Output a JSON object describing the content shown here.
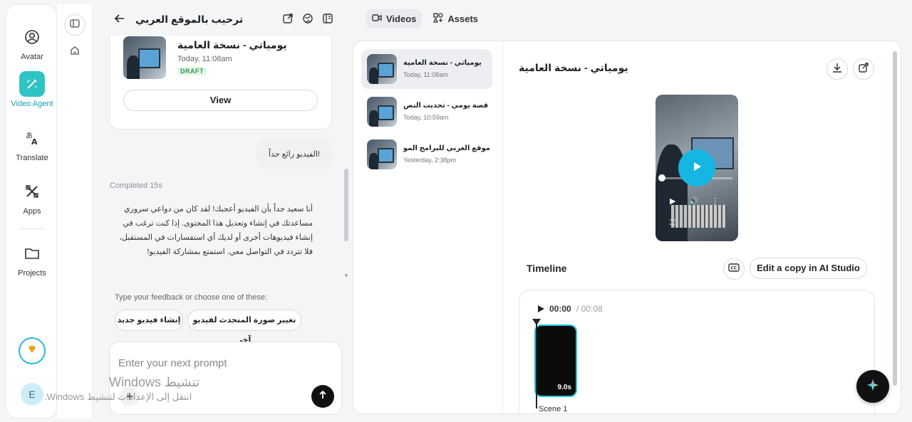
{
  "rail": {
    "items": [
      {
        "label": "Avatar",
        "icon": "avatar-icon"
      },
      {
        "label": "Video Agent",
        "icon": "video-agent-icon"
      },
      {
        "label": "Translate",
        "icon": "translate-icon"
      },
      {
        "label": "Apps",
        "icon": "apps-icon"
      },
      {
        "label": "Projects",
        "icon": "folder-icon"
      }
    ],
    "user_initial": "E"
  },
  "chat": {
    "title": "ترحيب بالموقع العربي",
    "video_card": {
      "title": "يومياتي - نسخة العامية",
      "time": "Today, 11:08am",
      "status": "DRAFT",
      "view_label": "View"
    },
    "user_message": "!الفيديو رائع جداً",
    "completed": "Completed 15s",
    "reply": "أنا سعيد جداً بأن الفيديو أعجبك! لقد كان من دواعي سروري مساعدتك في إنشاء وتعديل هذا المحتوى. إذا كنت ترغب في إنشاء فيديوهات أخرى أو لديك أي استفسارات في المستقبل، فلا تتردد في التواصل معي. استمتع بمشاركة الفيديو!",
    "feedback_hint": "Type your feedback or choose one of these:",
    "chips": [
      "إنشاء فيديو جديد",
      "تغيير صورة المتحدث لفيديو آخر"
    ],
    "prompt_placeholder": "Enter your next prompt"
  },
  "watermark": {
    "line1": "Windows تنشيط",
    "line2": "انتقل إلى الإعدادات لتنشيط Windows."
  },
  "tabs": [
    {
      "label": "Videos",
      "active": true
    },
    {
      "label": "Assets",
      "active": false
    }
  ],
  "videos": [
    {
      "title": "يومياتي - نسخة العامية",
      "date": "Today, 11:08am"
    },
    {
      "title": "قصة يومي - تحديث النص",
      "date": "Today, 10:59am"
    },
    {
      "title": "موقع العربي للبرامج الموثوقة...",
      "date": "Yesterday, 2:38pm"
    }
  ],
  "detail": {
    "title": "يومياتي - نسخة العامية",
    "timeline_label": "Timeline",
    "edit_copy_label": "Edit a copy in AI Studio",
    "time_current": "00:00",
    "time_total": "/ 00:08",
    "scene_duration": "9.0s",
    "scene_label": "Scene 1"
  },
  "colors": {
    "accent": "#2ec4c4",
    "play": "#16b6e3",
    "scene_border": "#23c2e0"
  }
}
